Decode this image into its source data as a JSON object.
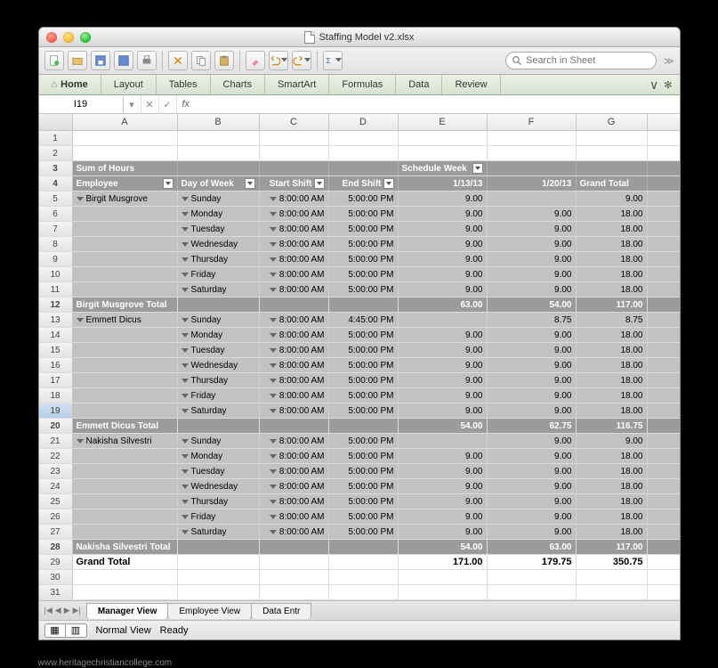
{
  "window": {
    "title": "Staffing Model v2.xlsx"
  },
  "search": {
    "placeholder": "Search in Sheet"
  },
  "ribbon": {
    "tabs": [
      "Home",
      "Layout",
      "Tables",
      "Charts",
      "SmartArt",
      "Formulas",
      "Data",
      "Review"
    ]
  },
  "namebox": {
    "ref": "I19"
  },
  "columns": [
    "A",
    "B",
    "C",
    "D",
    "E",
    "F",
    "G"
  ],
  "pivot": {
    "title": "Sum of Hours",
    "schedule_label": "Schedule Week",
    "headers": {
      "employee": "Employee",
      "dow": "Day of Week",
      "start": "Start Shift",
      "end": "End Shift",
      "d1": "1/13/13",
      "d2": "1/20/13",
      "gt": "Grand Total"
    },
    "groups": [
      {
        "name": "Birgit Musgrove",
        "rows": [
          {
            "dow": "Sunday",
            "start": "8:00:00 AM",
            "end": "5:00:00 PM",
            "d1": "9.00",
            "d2": "",
            "gt": "9.00"
          },
          {
            "dow": "Monday",
            "start": "8:00:00 AM",
            "end": "5:00:00 PM",
            "d1": "9.00",
            "d2": "9.00",
            "gt": "18.00"
          },
          {
            "dow": "Tuesday",
            "start": "8:00:00 AM",
            "end": "5:00:00 PM",
            "d1": "9.00",
            "d2": "9.00",
            "gt": "18.00"
          },
          {
            "dow": "Wednesday",
            "start": "8:00:00 AM",
            "end": "5:00:00 PM",
            "d1": "9.00",
            "d2": "9.00",
            "gt": "18.00"
          },
          {
            "dow": "Thursday",
            "start": "8:00:00 AM",
            "end": "5:00:00 PM",
            "d1": "9.00",
            "d2": "9.00",
            "gt": "18.00"
          },
          {
            "dow": "Friday",
            "start": "8:00:00 AM",
            "end": "5:00:00 PM",
            "d1": "9.00",
            "d2": "9.00",
            "gt": "18.00"
          },
          {
            "dow": "Saturday",
            "start": "8:00:00 AM",
            "end": "5:00:00 PM",
            "d1": "9.00",
            "d2": "9.00",
            "gt": "18.00"
          }
        ],
        "total": {
          "label": "Birgit Musgrove Total",
          "d1": "63.00",
          "d2": "54.00",
          "gt": "117.00"
        }
      },
      {
        "name": "Emmett Dicus",
        "rows": [
          {
            "dow": "Sunday",
            "start": "8:00:00 AM",
            "end": "4:45:00 PM",
            "d1": "",
            "d2": "8.75",
            "gt": "8.75"
          },
          {
            "dow": "Monday",
            "start": "8:00:00 AM",
            "end": "5:00:00 PM",
            "d1": "9.00",
            "d2": "9.00",
            "gt": "18.00"
          },
          {
            "dow": "Tuesday",
            "start": "8:00:00 AM",
            "end": "5:00:00 PM",
            "d1": "9.00",
            "d2": "9.00",
            "gt": "18.00"
          },
          {
            "dow": "Wednesday",
            "start": "8:00:00 AM",
            "end": "5:00:00 PM",
            "d1": "9.00",
            "d2": "9.00",
            "gt": "18.00"
          },
          {
            "dow": "Thursday",
            "start": "8:00:00 AM",
            "end": "5:00:00 PM",
            "d1": "9.00",
            "d2": "9.00",
            "gt": "18.00"
          },
          {
            "dow": "Friday",
            "start": "8:00:00 AM",
            "end": "5:00:00 PM",
            "d1": "9.00",
            "d2": "9.00",
            "gt": "18.00"
          },
          {
            "dow": "Saturday",
            "start": "8:00:00 AM",
            "end": "5:00:00 PM",
            "d1": "9.00",
            "d2": "9.00",
            "gt": "18.00"
          }
        ],
        "total": {
          "label": "Emmett Dicus Total",
          "d1": "54.00",
          "d2": "62.75",
          "gt": "116.75"
        }
      },
      {
        "name": "Nakisha Silvestri",
        "rows": [
          {
            "dow": "Sunday",
            "start": "8:00:00 AM",
            "end": "5:00:00 PM",
            "d1": "",
            "d2": "9.00",
            "gt": "9.00"
          },
          {
            "dow": "Monday",
            "start": "8:00:00 AM",
            "end": "5:00:00 PM",
            "d1": "9.00",
            "d2": "9.00",
            "gt": "18.00"
          },
          {
            "dow": "Tuesday",
            "start": "8:00:00 AM",
            "end": "5:00:00 PM",
            "d1": "9.00",
            "d2": "9.00",
            "gt": "18.00"
          },
          {
            "dow": "Wednesday",
            "start": "8:00:00 AM",
            "end": "5:00:00 PM",
            "d1": "9.00",
            "d2": "9.00",
            "gt": "18.00"
          },
          {
            "dow": "Thursday",
            "start": "8:00:00 AM",
            "end": "5:00:00 PM",
            "d1": "9.00",
            "d2": "9.00",
            "gt": "18.00"
          },
          {
            "dow": "Friday",
            "start": "8:00:00 AM",
            "end": "5:00:00 PM",
            "d1": "9.00",
            "d2": "9.00",
            "gt": "18.00"
          },
          {
            "dow": "Saturday",
            "start": "8:00:00 AM",
            "end": "5:00:00 PM",
            "d1": "9.00",
            "d2": "9.00",
            "gt": "18.00"
          }
        ],
        "total": {
          "label": "Nakisha Silvestri Total",
          "d1": "54.00",
          "d2": "63.00",
          "gt": "117.00"
        }
      }
    ],
    "grand": {
      "label": "Grand Total",
      "d1": "171.00",
      "d2": "179.75",
      "gt": "350.75"
    }
  },
  "sheets": {
    "tabs": [
      "Manager View",
      "Employee View",
      "Data Entr"
    ],
    "active": 0
  },
  "status": {
    "view": "Normal View",
    "state": "Ready"
  },
  "credit": "www.heritagechristiancollege.com"
}
